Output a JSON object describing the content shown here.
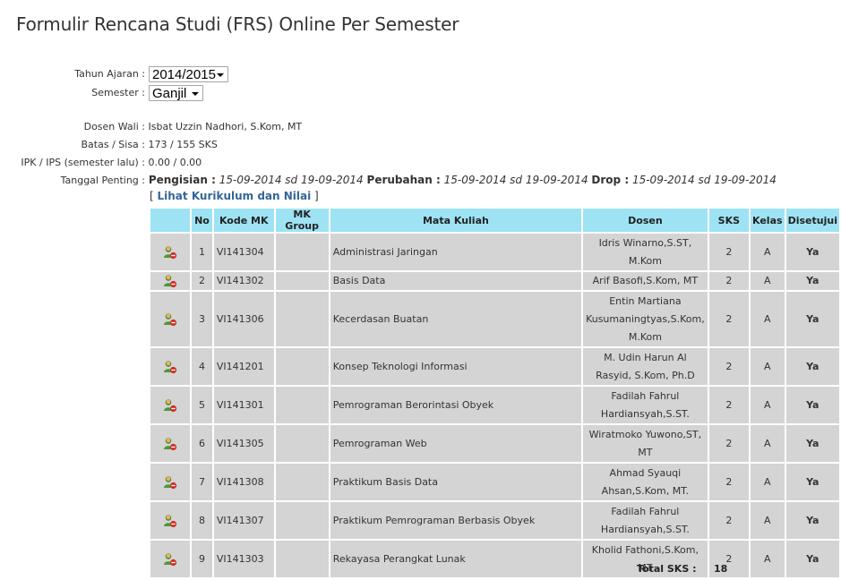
{
  "title": "Formulir Rencana Studi (FRS) Online Per Semester",
  "form": {
    "tahun_label": "Tahun Ajaran :",
    "tahun_value": "2014/2015",
    "semester_label": "Semester :",
    "semester_value": "Ganjil"
  },
  "info": {
    "dosen_label": "Dosen Wali :",
    "dosen_value": "Isbat Uzzin Nadhori, S.Kom, MT",
    "batas_label": "Batas / Sisa :",
    "batas_value": "173 / 155 SKS",
    "ipk_label": "IPK / IPS (semester lalu) :",
    "ipk_value": "0.00 / 0.00",
    "tanggal_label": "Tanggal Penting :",
    "pengisian_label": "Pengisian :",
    "pengisian_value": "15-09-2014 sd 19-09-2014",
    "perubahan_label": "Perubahan :",
    "perubahan_value": "15-09-2014 sd 19-09-2014",
    "drop_label": "Drop :",
    "drop_value": "15-09-2014 sd 19-09-2014"
  },
  "kurikulum_link": "Lihat Kurikulum dan Nilai",
  "table": {
    "headers": [
      "No",
      "Kode MK",
      "MK Group",
      "Mata Kuliah",
      "Dosen",
      "SKS",
      "Kelas",
      "Disetujui"
    ],
    "rows": [
      {
        "no": "1",
        "kode": "VI141304",
        "group": "",
        "mk": "Administrasi Jaringan",
        "dosen": "Idris Winarno,S.ST, M.Kom",
        "sks": "2",
        "kelas": "A",
        "setuju": "Ya"
      },
      {
        "no": "2",
        "kode": "VI141302",
        "group": "",
        "mk": "Basis Data",
        "dosen": "Arif Basofi,S.Kom, MT",
        "sks": "2",
        "kelas": "A",
        "setuju": "Ya"
      },
      {
        "no": "3",
        "kode": "VI141306",
        "group": "",
        "mk": "Kecerdasan Buatan",
        "dosen": "Entin Martiana Kusumaningtyas,S.Kom, M.Kom",
        "sks": "2",
        "kelas": "A",
        "setuju": "Ya"
      },
      {
        "no": "4",
        "kode": "VI141201",
        "group": "",
        "mk": "Konsep Teknologi Informasi",
        "dosen": "M. Udin Harun Al Rasyid, S.Kom, Ph.D",
        "sks": "2",
        "kelas": "A",
        "setuju": "Ya"
      },
      {
        "no": "5",
        "kode": "VI141301",
        "group": "",
        "mk": "Pemrograman Berorintasi Obyek",
        "dosen": "Fadilah Fahrul Hardiansyah,S.ST.",
        "sks": "2",
        "kelas": "A",
        "setuju": "Ya"
      },
      {
        "no": "6",
        "kode": "VI141305",
        "group": "",
        "mk": "Pemrograman Web",
        "dosen": "Wiratmoko Yuwono,ST, MT",
        "sks": "2",
        "kelas": "A",
        "setuju": "Ya"
      },
      {
        "no": "7",
        "kode": "VI141308",
        "group": "",
        "mk": "Praktikum Basis Data",
        "dosen": "Ahmad Syauqi Ahsan,S.Kom, MT.",
        "sks": "2",
        "kelas": "A",
        "setuju": "Ya"
      },
      {
        "no": "8",
        "kode": "VI141307",
        "group": "",
        "mk": "Praktikum Pemrograman Berbasis Obyek",
        "dosen": "Fadilah Fahrul Hardiansyah,S.ST.",
        "sks": "2",
        "kelas": "A",
        "setuju": "Ya"
      },
      {
        "no": "9",
        "kode": "VI141303",
        "group": "",
        "mk": "Rekayasa Perangkat Lunak",
        "dosen": "Kholid Fathoni,S.Kom, MT",
        "sks": "2",
        "kelas": "A",
        "setuju": "Ya"
      }
    ]
  },
  "total": {
    "label": "Total SKS :",
    "value": "18"
  }
}
